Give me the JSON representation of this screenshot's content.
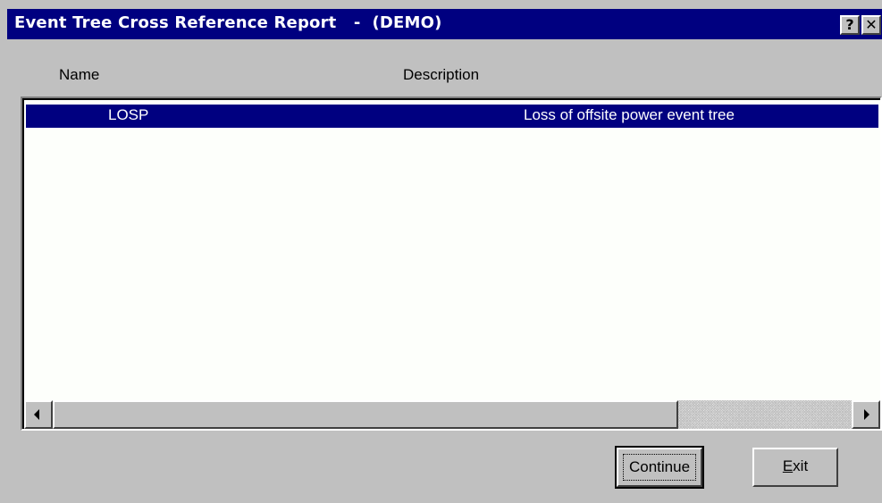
{
  "window": {
    "title": "Event Tree Cross Reference Report   -  (DEMO)",
    "help_label": "?",
    "close_label": "✕"
  },
  "columns": {
    "name": "Name",
    "description": "Description"
  },
  "rows": [
    {
      "name": "LOSP",
      "description": "Loss of offsite power event tree",
      "selected": true
    }
  ],
  "buttons": {
    "continue_label": "Continue",
    "exit_mnemonic": "E",
    "exit_rest": "xit"
  },
  "colors": {
    "titlebar": "#000080",
    "selection": "#000080",
    "face": "#c0c0c0"
  }
}
